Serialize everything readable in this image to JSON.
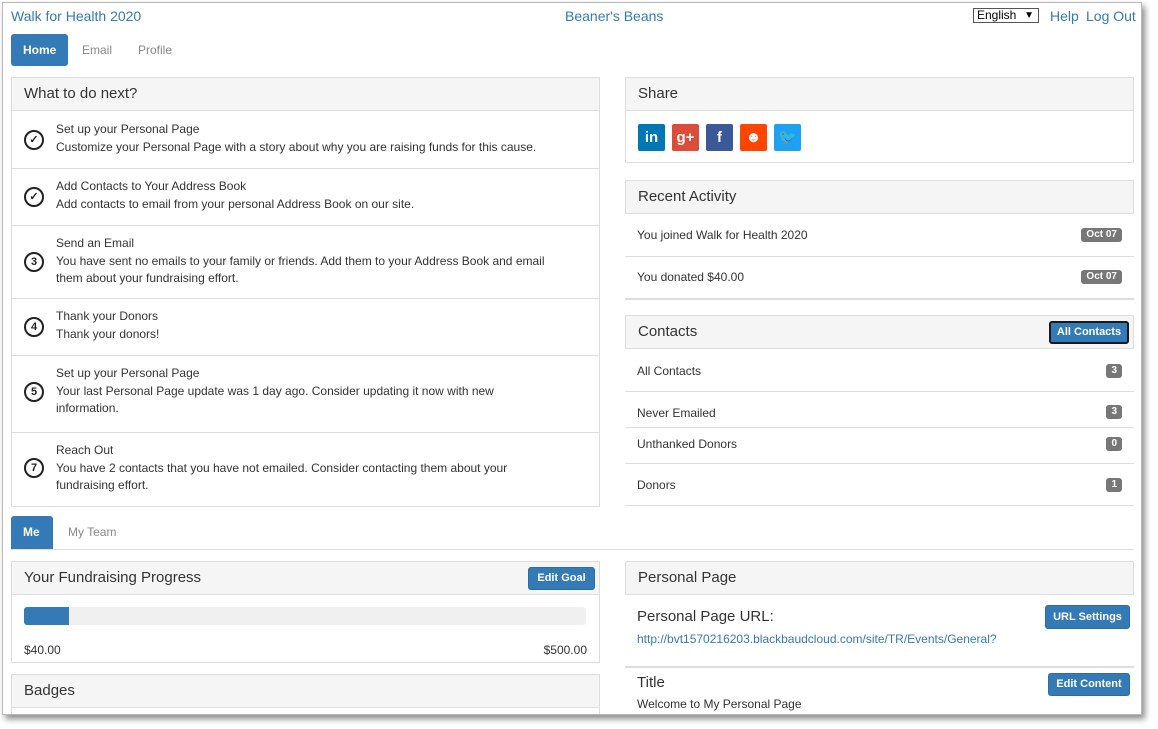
{
  "header": {
    "event_title": "Walk for Health 2020",
    "org_title": "Beaner's Beans",
    "language": "English",
    "help": "Help",
    "logout": "Log Out"
  },
  "tabs": [
    "Home",
    "Email",
    "Profile"
  ],
  "next_steps": {
    "heading": "What to do next?",
    "items": [
      {
        "status": "done",
        "number": "",
        "title": "Set up your Personal Page",
        "desc": "Customize your Personal Page with a story about why you are raising funds for this cause."
      },
      {
        "status": "done",
        "number": "",
        "title": "Add Contacts to Your Address Book",
        "desc": "Add contacts to email from your personal Address Book on our site."
      },
      {
        "status": "todo",
        "number": "3",
        "title": "Send an Email",
        "desc": "You have sent no emails to your family or friends. Add them to your Address Book and email them about your fundraising effort."
      },
      {
        "status": "todo",
        "number": "4",
        "title": "Thank your Donors",
        "desc": "Thank your donors!"
      },
      {
        "status": "todo",
        "number": "5",
        "title": "Set up your Personal Page",
        "desc": "Your last Personal Page update was 1 day ago. Consider updating it now with new information."
      },
      {
        "status": "todo",
        "number": "7",
        "title": "Reach Out",
        "desc": "You have 2 contacts that you have not emailed. Consider contacting them about your fundraising effort."
      }
    ]
  },
  "share": {
    "heading": "Share",
    "icons": [
      {
        "name": "linkedin-icon",
        "glyph": "in",
        "color": "#0077b5"
      },
      {
        "name": "google-plus-icon",
        "glyph": "g+",
        "color": "#dd4b39"
      },
      {
        "name": "facebook-icon",
        "glyph": "f",
        "color": "#3b5998"
      },
      {
        "name": "reddit-icon",
        "glyph": "☻",
        "color": "#ff4500"
      },
      {
        "name": "twitter-icon",
        "glyph": "🐦",
        "color": "#1da1f2"
      }
    ]
  },
  "recent_activity": {
    "heading": "Recent Activity",
    "items": [
      {
        "text": "You joined Walk for Health 2020",
        "date": "Oct 07"
      },
      {
        "text": "You donated $40.00",
        "date": "Oct 07"
      }
    ]
  },
  "contacts": {
    "heading": "Contacts",
    "button": "All Contacts",
    "items": [
      {
        "label": "All Contacts",
        "count": "3"
      },
      {
        "label": "Never Emailed",
        "count": "3"
      },
      {
        "label": "Unthanked Donors",
        "count": "0"
      },
      {
        "label": "Donors",
        "count": "1"
      }
    ]
  },
  "sub_tabs": [
    "Me",
    "My Team"
  ],
  "progress": {
    "heading": "Your Fundraising Progress",
    "edit_goal": "Edit Goal",
    "raised": "$40.00",
    "goal": "$500.00",
    "fraction": 0.08
  },
  "badges": {
    "heading": "Badges"
  },
  "personal_page": {
    "heading": "Personal Page",
    "url_label": "Personal Page URL:",
    "url_settings": "URL Settings",
    "url": "http://bvt1570216203.blackbaudcloud.com/site/TR/Events/General?",
    "title_label": "Title",
    "edit_content": "Edit Content",
    "title_value": "Welcome to My Personal Page"
  },
  "colors": {
    "primary": "#337ab7",
    "badge": "#777777"
  }
}
